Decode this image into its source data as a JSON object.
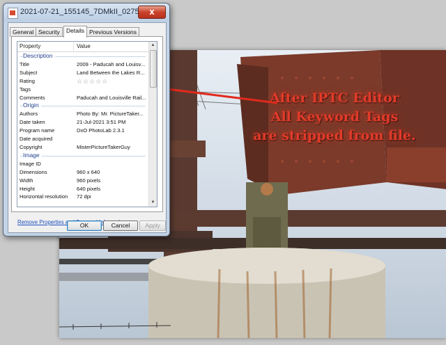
{
  "window": {
    "title": "2021-07-21_155145_7DMkII_0275_XnView_Post-IPTC ...",
    "close_label": "x"
  },
  "tabs": [
    {
      "label": "General",
      "active": false
    },
    {
      "label": "Security",
      "active": false
    },
    {
      "label": "Details",
      "active": true
    },
    {
      "label": "Previous Versions",
      "active": false
    }
  ],
  "list": {
    "header": {
      "property": "Property",
      "value": "Value"
    },
    "sections": [
      {
        "label": "Description",
        "rows": [
          {
            "property": "Title",
            "value": "2009 - Paducah and Louisv..."
          },
          {
            "property": "Subject",
            "value": "Land Between the Lakes R..."
          },
          {
            "property": "Rating",
            "value": "☆☆☆☆☆"
          },
          {
            "property": "Tags",
            "value": ""
          },
          {
            "property": "Comments",
            "value": "Paducah and Louisville Rail..."
          }
        ]
      },
      {
        "label": "Origin",
        "rows": [
          {
            "property": "Authors",
            "value": "Photo By:  Mr. PictureTaker..."
          },
          {
            "property": "Date taken",
            "value": "21-Jul-2021 3:51 PM"
          },
          {
            "property": "Program name",
            "value": "DxO PhotoLab 2.3.1"
          },
          {
            "property": "Date acquired",
            "value": ""
          },
          {
            "property": "Copyright",
            "value": "MisterPictureTakerGuy"
          }
        ]
      },
      {
        "label": "Image",
        "rows": [
          {
            "property": "Image ID",
            "value": ""
          },
          {
            "property": "Dimensions",
            "value": "960 x 640"
          },
          {
            "property": "Width",
            "value": "960 pixels"
          },
          {
            "property": "Height",
            "value": "640 pixels"
          },
          {
            "property": "Horizontal resolution",
            "value": "72 dpi"
          }
        ]
      }
    ]
  },
  "remove_link": "Remove Properties and Personal Information",
  "buttons": {
    "ok": "OK",
    "cancel": "Cancel",
    "apply": "Apply"
  },
  "annotation": {
    "lines": [
      "After IPTC Editor",
      "All Keyword Tags",
      "are stripped from file."
    ],
    "color": "#e23b2a"
  },
  "colors": {
    "accent_link": "#1f4fbf",
    "section_label": "#1e3f8a"
  }
}
